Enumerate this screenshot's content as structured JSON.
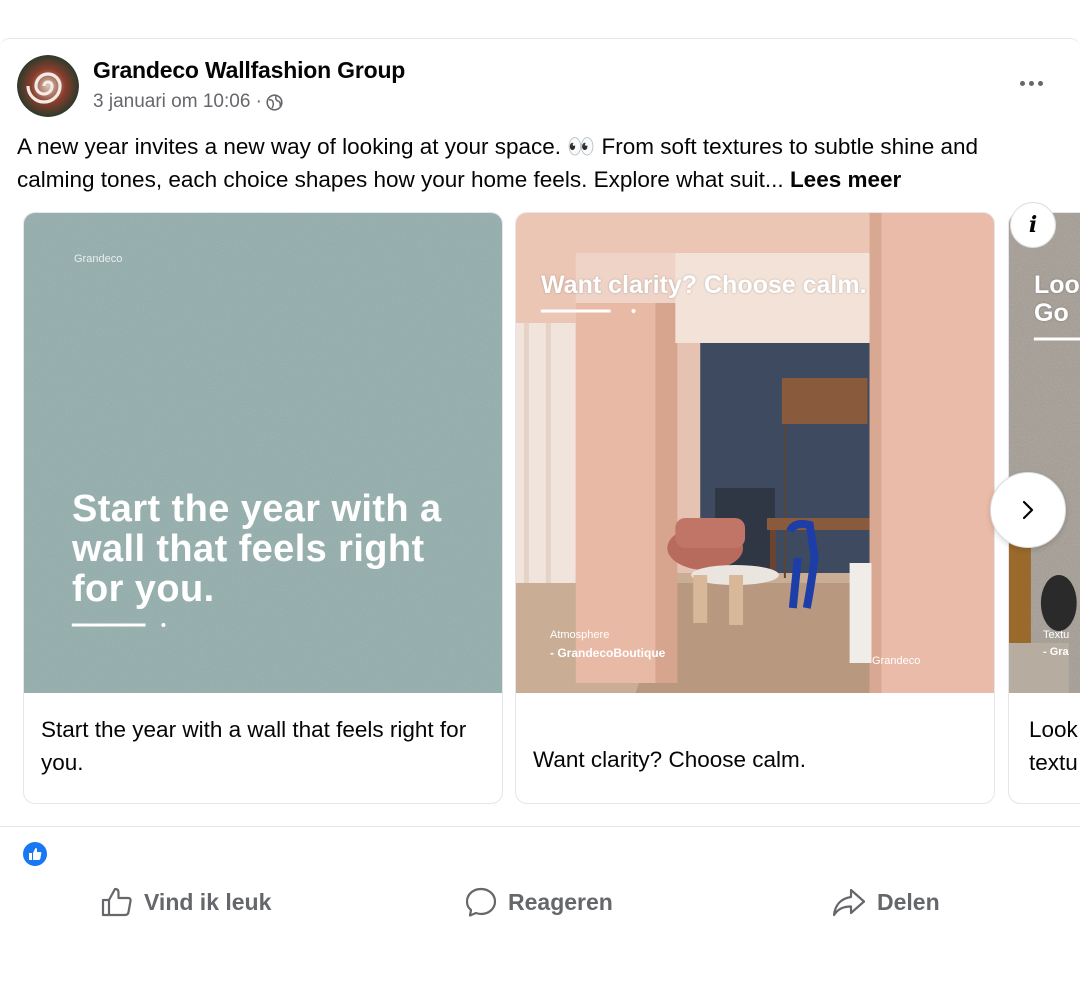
{
  "post": {
    "author": "Grandeco Wallfashion Group",
    "timestamp": "3 januari om 10:06 ·",
    "text": "A new year invites a new way of looking at your space. 👀 From soft textures to subtle shine and calming tones, each choice shapes how your home feels. Explore what suit...",
    "see_more": "Lees meer"
  },
  "carousel": {
    "cards": [
      {
        "brand": "Grandeco",
        "overlay": "Start the year with a wall that feels right for you.",
        "caption": "Start the year with a wall that feels right for you."
      },
      {
        "overlay": "Want clarity? Choose calm.",
        "credit_1": "Atmosphere",
        "credit_2": "- GrandecoBoutique",
        "brand": "Grandeco",
        "caption": "Want clarity? Choose calm."
      },
      {
        "overlay_1": "Loo",
        "overlay_2": "Go",
        "credit_1": "Textu",
        "credit_2": "- Gra",
        "caption_1": "Look",
        "caption_2": "textu"
      }
    ],
    "info_label": "i"
  },
  "actions": {
    "like": "Vind ik leuk",
    "comment": "Reageren",
    "share": "Delen"
  },
  "colors": {
    "text": "#050505",
    "secondary": "#65676b",
    "accent": "#1877f2",
    "teal_wall": "#8fa9a7",
    "pink_wall": "#e9bba8",
    "navy_wall": "#3d4a60"
  },
  "icons": [
    "globe-icon",
    "more-options-icon",
    "info-icon",
    "chevron-right-icon",
    "like-reaction-icon",
    "thumbs-up-icon",
    "comment-icon",
    "share-icon"
  ]
}
